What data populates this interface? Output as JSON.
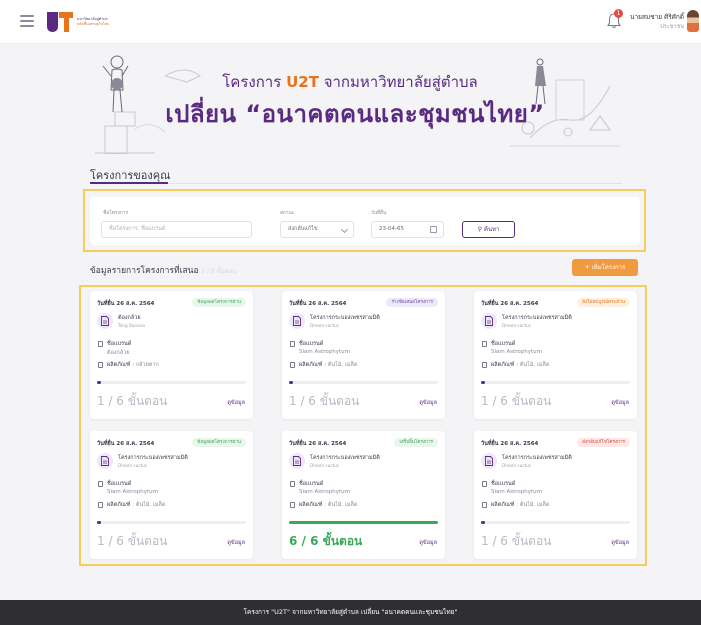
{
  "header": {
    "logo_line1": "มหาวิทยาลัยสู่ตำบล",
    "logo_line2": "พลิกฟื้นเศรษฐกิจไทย",
    "notification_count": "1",
    "user_name": "นายสมชาย ศิริศักดิ์",
    "user_role": "ประชาชน"
  },
  "hero": {
    "title_prefix": "โครงการ",
    "title_brand": "U2T",
    "title_suffix": "จากมหาวิทยาลัยสู่ตำบล",
    "headline": "เปลี่ยน “อนาคตคนและชุมชนไทย”"
  },
  "section": {
    "title": "โครงการของคุณ"
  },
  "filter": {
    "project_label": "ชื่อโครงการ",
    "project_placeholder": "ชื่อโครงการ, ชื่อแบรนด์",
    "status_label": "สถานะ",
    "status_value": "ส่งกลับแก้ไข",
    "date_label": "วันที่ยื่น",
    "date_value": "23-04-65",
    "search_label": "ค้นหา"
  },
  "list": {
    "title": "ข้อมูลรายการโครงการที่เสนอ",
    "title_faint": "1 / 6 ขั้นตอน",
    "add_label": "เพิ่มโครงการ"
  },
  "cards": [
    {
      "date": "วันที่ยื่น 26 ส.ค. 2564",
      "badge": "ข้อมูลผลโครงการผ่าน",
      "name": "ต้องกล้วย",
      "sub": "Tong Banana",
      "brand_label": "ชื่อแบรนด์",
      "brand": "ต้องกล้วย",
      "product_label": "ผลิตภัณฑ์",
      "product": "กล้วยตาก",
      "steps": "1 / 6 ขั้นตอน",
      "progress": 0.03,
      "detail": "ดูข้อมูล"
    },
    {
      "date": "วันที่ยื่น 26 ส.ค. 2564",
      "badge": "ร่างข้อเสนอโครงการ",
      "name": "โครงการกระบองเพชรสามมิติ",
      "sub": "Dream cactus",
      "brand_label": "ชื่อแบรนด์",
      "brand": "Siam Astrophytum",
      "product_label": "ผลิตภัณฑ์",
      "product": "ต้นไม้, เมล็ด",
      "steps": "1 / 6 ขั้นตอน",
      "progress": 0.03,
      "detail": "ดูข้อมูล"
    },
    {
      "date": "วันที่ยื่น 26 ส.ค. 2564",
      "badge": "ยังไม่สมบูรณ์ครบถ้วน",
      "name": "โครงการกระบองเพชรสามมิติ",
      "sub": "Dream cactus",
      "brand_label": "ชื่อแบรนด์",
      "brand": "Siam Astrophytum",
      "product_label": "ผลิตภัณฑ์",
      "product": "ต้นไม้, เมล็ด",
      "steps": "1 / 6 ขั้นตอน",
      "progress": 0.03,
      "detail": "ดูข้อมูล"
    },
    {
      "date": "วันที่ยื่น 26 ส.ค. 2564",
      "badge": "ข้อมูลผลโครงการผ่าน",
      "name": "โครงการกระบองเพชรสามมิติ",
      "sub": "Dream cactus",
      "brand_label": "ชื่อแบรนด์",
      "brand": "Siam Astrophytum",
      "product_label": "ผลิตภัณฑ์",
      "product": "ต้นไม้, เมล็ด",
      "steps": "1 / 6 ขั้นตอน",
      "progress": 0.03,
      "detail": "ดูข้อมูล"
    },
    {
      "date": "วันที่ยื่น 26 ส.ค. 2564",
      "badge": "เสร็จสิ้นโครงการ",
      "name": "โครงการกระบองเพชรสามมิติ",
      "sub": "Dream cactus",
      "brand_label": "ชื่อแบรนด์",
      "brand": "Siam Astrophytum",
      "product_label": "ผลิตภัณฑ์",
      "product": "ต้นไม้, เมล็ด",
      "steps": "6 / 6 ขั้นตอน",
      "progress": 1.0,
      "detail": "ดูข้อมูล"
    },
    {
      "date": "วันที่ยื่น 26 ส.ค. 2564",
      "badge": "ส่งกลับแก้ไขโครงการ",
      "name": "โครงการกระบองเพชรสามมิติ",
      "sub": "Dream cactus",
      "brand_label": "ชื่อแบรนด์",
      "brand": "Siam Astrophytum",
      "product_label": "ผลิตภัณฑ์",
      "product": "ต้นไม้, เมล็ด",
      "steps": "1 / 6 ขั้นตอน",
      "progress": 0.03,
      "detail": "ดูข้อมูล"
    }
  ],
  "colors": {
    "brand_purple": "#5a2a82",
    "brand_orange": "#e8731e",
    "highlight": "#f5cd5a",
    "progress_default": "#5a2a82",
    "progress_done": "#39a85a"
  },
  "footer": {
    "text": "โครงการ \"U2T\" จากมหาวิทยาลัยสู่ตำบล เปลี่ยน \"อนาคตคนและชุมชนไทย\""
  }
}
